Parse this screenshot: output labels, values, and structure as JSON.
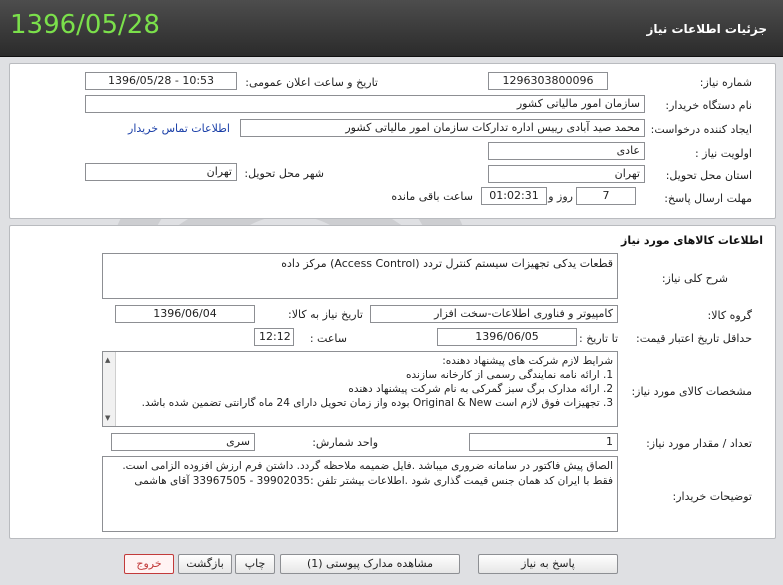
{
  "header": {
    "date": "1396/05/28",
    "title": "جزئیات اطلاعات نیاز"
  },
  "need": {
    "number_label": "شماره نیاز:",
    "number": "1296303800096",
    "announce_label": "تاریخ و ساعت اعلان عمومی:",
    "announce_value": "1396/05/28 - 10:53",
    "buyer_org_label": "نام دستگاه خریدار:",
    "buyer_org": "سازمان امور مالیاتی کشور",
    "creator_label": "ایجاد کننده درخواست:",
    "creator": "محمد صید آبادی  رییس اداره تدارکات سازمان امور مالیاتی کشور",
    "contact_link": "اطلاعات تماس خریدار",
    "priority_label": "اولویت نیاز :",
    "priority": "عادی",
    "province_label": "استان محل تحویل:",
    "province": "تهران",
    "city_label": "شهر محل تحویل:",
    "city": "تهران",
    "deadline_label": "مهلت ارسال پاسخ:",
    "deadline_days": "7",
    "days_word": "روز و",
    "deadline_time": "01:02:31",
    "remaining_word": "ساعت باقی مانده"
  },
  "goods": {
    "section_title": "اطلاعات کالاهای مورد نیاز",
    "desc_label": "شرح کلی نیاز:",
    "desc": "قطعات یدکی تجهیزات سیستم کنترل تردد (Access Control) مرکز داده",
    "group_label": "گروه کالا:",
    "group": "کامپیوتر و فناوری اطلاعات-سخت افزار",
    "need_date_label": "تاریخ نیاز به کالا:",
    "need_date": "1396/06/04",
    "validity_label": "حداقل تاریخ اعتبار قیمت:",
    "until_label": "تا تاریخ :",
    "validity_date": "1396/06/05",
    "hour_label": "ساعت :",
    "validity_time": "12:12",
    "specs_label": "مشخصات کالای مورد نیاز:",
    "specs": [
      "شرایط لازم شرکت های پیشنهاد دهنده:",
      "1. ارائه نامه نمایندگی رسمی از کارخانه سازنده",
      "2. ارائه مدارک برگ سبز گمرکی به نام شرکت پیشنهاد دهنده",
      "3. تجهیزات فوق لازم است Original & New بوده واز زمان تحویل دارای 24 ماه گارانتی تضمین شده باشد."
    ],
    "qty_label": "تعداد / مقدار مورد نیاز:",
    "qty": "1",
    "unit_label": "واحد شمارش:",
    "unit": "سری",
    "notes_label": "توضیحات خریدار:",
    "notes": "الصاق پیش فاکتور در سامانه ضروری میباشد .فایل ضمیمه ملاحظه گردد. داشتن فرم ارزش افزوده الزامی است. فقط با ایران کد همان جنس قیمت گذاری شود .اطلاعات بیشتر تلفن :39902035 - 33967505 آقای هاشمی"
  },
  "buttons": {
    "reply": "پاسخ به نیاز",
    "attachments": "مشاهده مدارک پیوستی (1)",
    "print": "چاپ",
    "back": "بازگشت",
    "exit": "خروج"
  },
  "colors": {
    "header_date": "#7be04b",
    "link": "#1a3fa8",
    "exit": "#c23a3a"
  }
}
